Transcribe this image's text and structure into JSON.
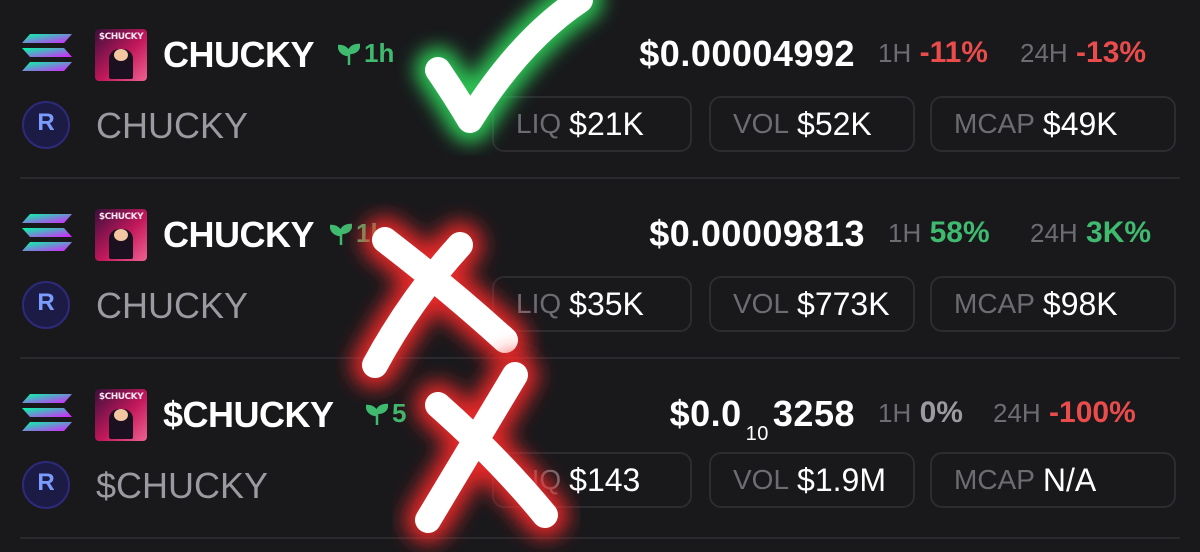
{
  "tokens": [
    {
      "name": "CHUCKY",
      "age": "1h",
      "symbol": "CHUCKY",
      "price": "$0.00004992",
      "ch1h_label": "1H",
      "ch1h": "-11%",
      "ch24h_label": "24H",
      "ch24h": "-13%",
      "liq_label": "LIQ",
      "liq": "$21K",
      "vol_label": "VOL",
      "vol": "$52K",
      "mcap_label": "MCAP",
      "mcap": "$49K",
      "avatar_text": "$CHUCKY"
    },
    {
      "name": "CHUCKY",
      "age": "1h",
      "symbol": "CHUCKY",
      "price": "$0.00009813",
      "ch1h_label": "1H",
      "ch1h": "58%",
      "ch24h_label": "24H",
      "ch24h": "3K%",
      "liq_label": "LIQ",
      "liq": "$35K",
      "vol_label": "VOL",
      "vol": "$773K",
      "mcap_label": "MCAP",
      "mcap": "$98K",
      "avatar_text": "$CHUCKY"
    },
    {
      "name": "$CHUCKY",
      "age": "5",
      "symbol": "$CHUCKY",
      "price_main": "$0.0",
      "price_sub": "10",
      "price_tail": "3258",
      "ch1h_label": "1H",
      "ch1h": "0%",
      "ch24h_label": "24H",
      "ch24h": "-100%",
      "liq_label": "LIQ",
      "liq": "$143",
      "vol_label": "VOL",
      "vol": "$1.9M",
      "mcap_label": "MCAP",
      "mcap": "N/A",
      "avatar_text": "$CHUCKY"
    }
  ],
  "colors": {
    "negative": "#ea4b4b",
    "positive": "#3fba6f",
    "neutral": "#9a9aa0",
    "check": "#2fd35a",
    "cross": "#ff2a2a"
  },
  "icons": {
    "chain": "solana-icon",
    "dex": "raydium-icon",
    "age": "seedling-icon",
    "verdict_good": "checkmark-icon",
    "verdict_bad": "cross-icon"
  }
}
